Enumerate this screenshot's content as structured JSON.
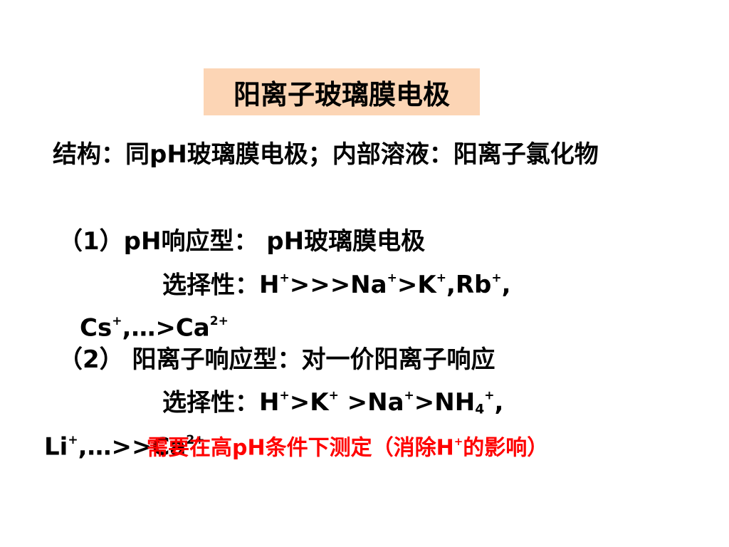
{
  "slide": {
    "title": "阳离子玻璃膜电极",
    "structure_line": "结构：同pH玻璃膜电极；内部溶液：阳离子氯化物",
    "section1": {
      "label": "（1）pH响应型：  pH玻璃膜电极",
      "selectivity_prefix": "选择性：",
      "selectivity_text": "H+>>>Na+>K+,Rb+,",
      "selectivity_cont": "Cs+,…>Ca2+"
    },
    "section2": {
      "label": "（2） 阳离子响应型：对一价阳离子响应",
      "selectivity_prefix": "选择性：",
      "selectivity_text": "H+>K+ >Na+>NH4+,",
      "selectivity_cont": "Li+,…>>Ca2+"
    },
    "note": "需要在高pH条件下测定（消除H+的影响）",
    "colors": {
      "title_bg": "#fcd5b5",
      "note": "#ff0000",
      "text": "#000000"
    }
  }
}
